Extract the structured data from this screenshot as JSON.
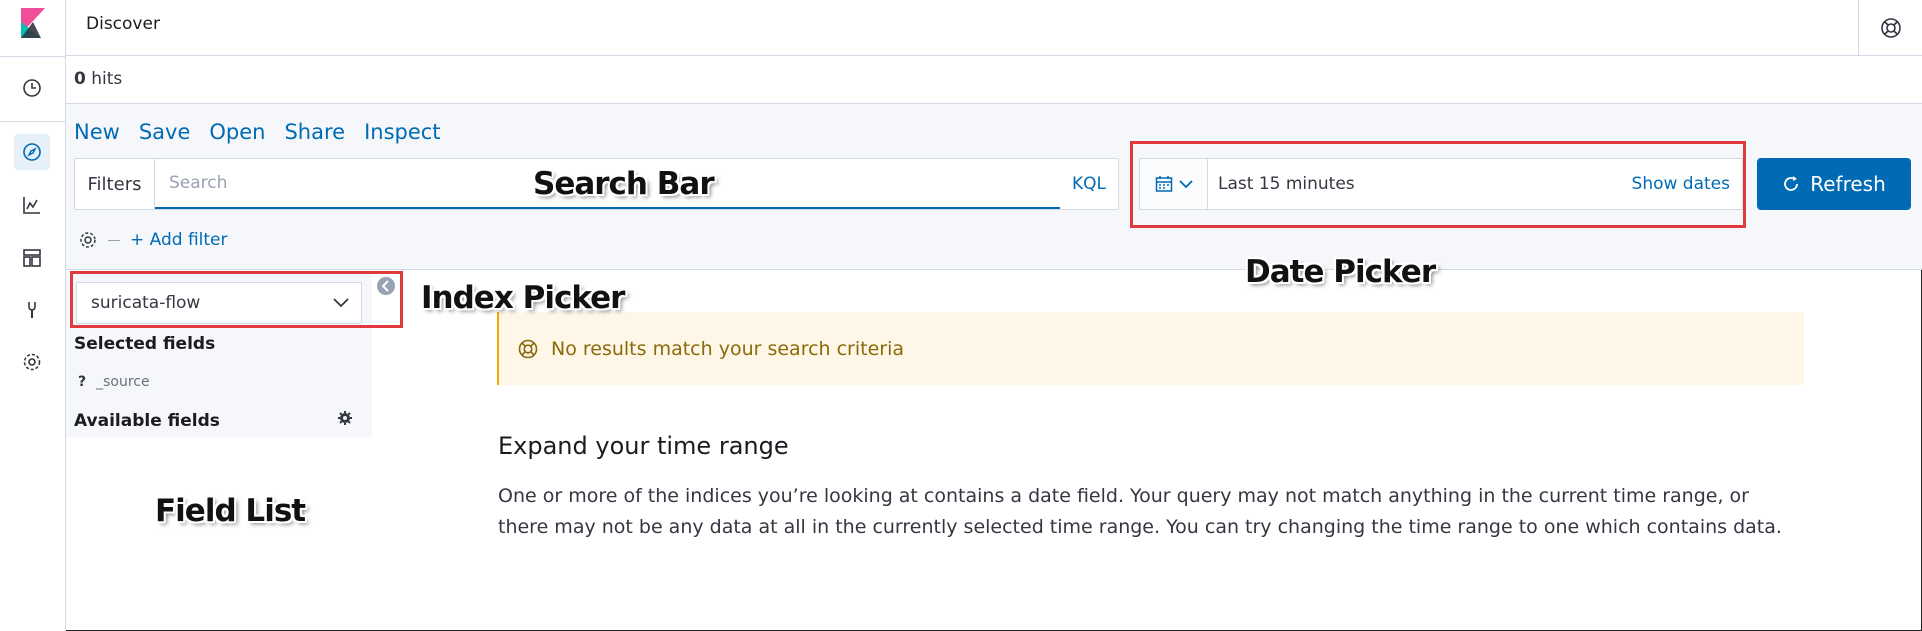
{
  "header": {
    "title": "Discover"
  },
  "hits": {
    "count": "0",
    "label": "hits"
  },
  "menu": {
    "new": "New",
    "save": "Save",
    "open": "Open",
    "share": "Share",
    "inspect": "Inspect"
  },
  "query": {
    "filters_label": "Filters",
    "search_placeholder": "Search",
    "language": "KQL",
    "add_filter": "+ Add filter"
  },
  "date": {
    "range": "Last 15 minutes",
    "show_dates": "Show dates"
  },
  "refresh": {
    "label": "Refresh"
  },
  "sidebar": {
    "index_pattern": "suricata-flow",
    "selected_fields_title": "Selected fields",
    "source_type": "?",
    "source_field": "_source",
    "available_fields_title": "Available fields"
  },
  "main": {
    "callout": "No results match your search criteria",
    "expand_title": "Expand your time range",
    "expand_body": "One or more of the indices you’re looking at contains a date field. Your query may not match anything in the current time range, or there may not be any data at all in the currently selected time range. You can try changing the time range to one which contains data."
  },
  "annotations": {
    "search_bar": "Search Bar",
    "date_picker": "Date Picker",
    "index_picker": "Index Picker",
    "field_list": "Field List"
  },
  "colors": {
    "accent": "#006bb4",
    "callout_bg": "#fef6e6",
    "annotation_box": "#e0393e"
  }
}
